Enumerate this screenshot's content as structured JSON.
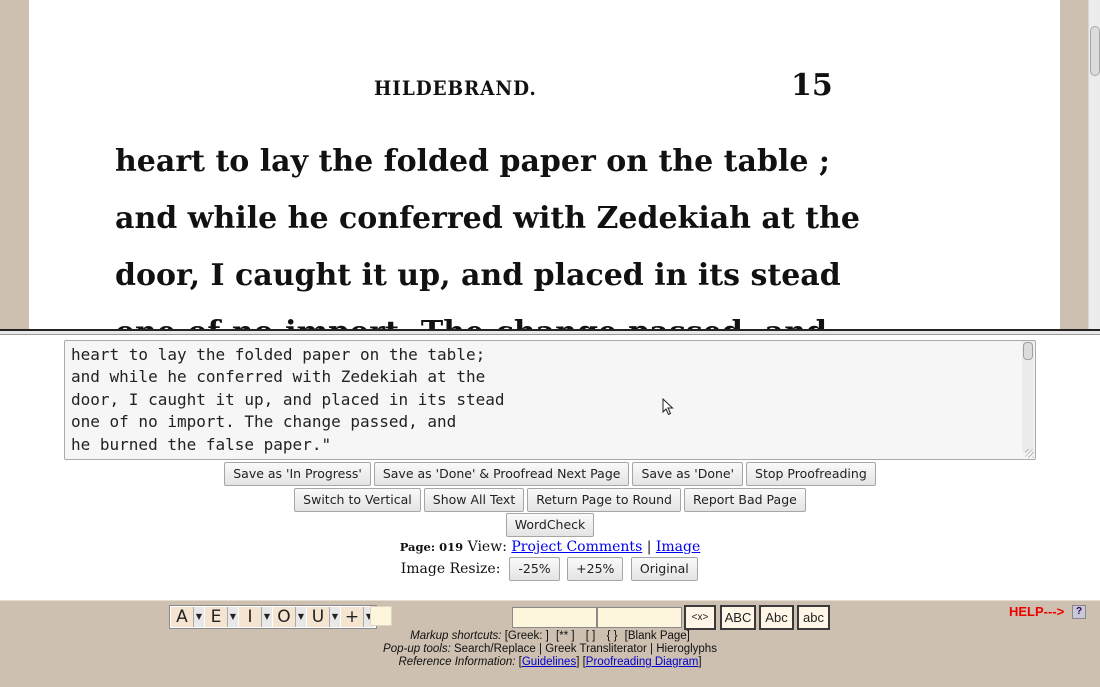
{
  "scan": {
    "running_header": "HILDEBRAND.",
    "page_number": "15",
    "lines": [
      "heart to lay the folded paper on the table ;",
      "and while he conferred with Zedekiah at the",
      "door, I caught it up, and placed in its stead",
      "one of no import. The change passed, and"
    ]
  },
  "editor": {
    "text": "heart to lay the folded paper on the table;\nand while he conferred with Zedekiah at the\ndoor, I caught it up, and placed in its stead\none of no import. The change passed, and\nhe burned the false paper.\""
  },
  "buttons": {
    "row1": [
      "Save as 'In Progress'",
      "Save as 'Done' & Proofread Next Page",
      "Save as 'Done'",
      "Stop Proofreading"
    ],
    "row2": [
      "Switch to Vertical",
      "Show All Text",
      "Return Page to Round",
      "Report Bad Page"
    ],
    "row3": [
      "WordCheck"
    ]
  },
  "page_info": {
    "page_label": "Page: 019",
    "view_label": "View:",
    "project_comments": "Project Comments",
    "separator": "|",
    "image_link": "Image"
  },
  "image_resize": {
    "label": "Image Resize:",
    "minus": "-25%",
    "plus": "+25%",
    "original": "Original"
  },
  "toolbox": {
    "char_groups": [
      {
        "char": "A",
        "icon": "dropdown-arrow"
      },
      {
        "char": "E",
        "icon": "dropdown-arrow"
      },
      {
        "char": "I",
        "icon": "dropdown-arrow"
      },
      {
        "char": "O",
        "icon": "dropdown-arrow"
      },
      {
        "char": "U",
        "icon": "dropdown-arrow"
      },
      {
        "char": "+",
        "icon": "dropdown-arrow"
      }
    ],
    "search_value": "",
    "replace_value": "",
    "swap_label": "<x>",
    "upper_label": "ABC",
    "title_label": "Abc",
    "lower_label": "abc",
    "help_label": "HELP--->",
    "help_icon": "?",
    "markup": {
      "label": "Markup shortcuts:",
      "items": [
        "[Greek: ]",
        "[** ]",
        "[ ]",
        "{ }",
        "[Blank Page]"
      ]
    },
    "popup": {
      "label": "Pop-up tools:",
      "items": [
        "Search/Replace",
        "| Greek Transliterator",
        "| Hieroglyphs"
      ]
    },
    "reference": {
      "label": "Reference Information:",
      "guidelines": "Guidelines",
      "diagram": "Proofreading Diagram"
    }
  }
}
